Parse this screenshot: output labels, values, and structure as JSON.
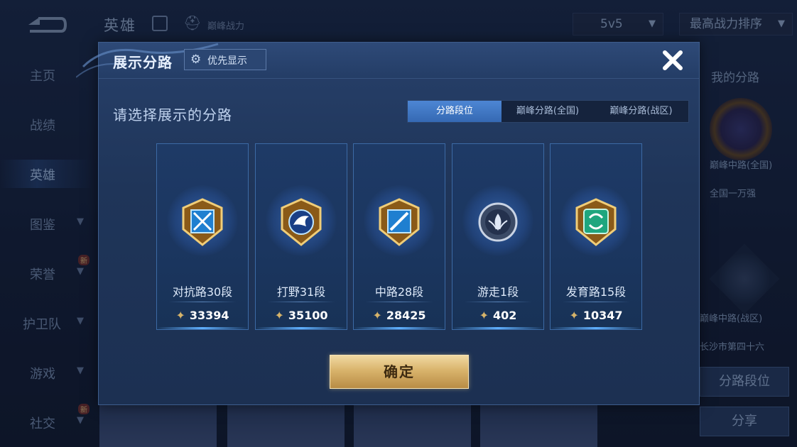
{
  "background": {
    "header_title": "英雄",
    "header_power_label": "巅峰战力",
    "mode_select": "5v5",
    "sort_select": "最高战力排序",
    "sidebar": [
      {
        "label": "主页",
        "chevron": false,
        "new": false
      },
      {
        "label": "战绩",
        "chevron": false,
        "new": false
      },
      {
        "label": "英雄",
        "chevron": false,
        "new": false,
        "active": true
      },
      {
        "label": "图鉴",
        "chevron": true,
        "new": false
      },
      {
        "label": "荣誉",
        "chevron": true,
        "new": true
      },
      {
        "label": "护卫队",
        "chevron": true,
        "new": false
      },
      {
        "label": "游戏",
        "chevron": true,
        "new": false
      },
      {
        "label": "社交",
        "chevron": true,
        "new": true
      }
    ],
    "new_badge": "新",
    "right_panel": {
      "title": "我的分路",
      "line1": "巅峰中路(全国)",
      "line2": "全国一万强",
      "line3": "巅峰中路(战区)",
      "line4": "长沙市第四十六",
      "btn1": "分路段位",
      "btn2": "分享"
    }
  },
  "modal": {
    "title": "展示分路",
    "priority_button": "优先显示",
    "subtitle": "请选择展示的分路",
    "tabs": [
      {
        "label": "分路段位",
        "active": true
      },
      {
        "label": "巅峰分路(全国)",
        "active": false
      },
      {
        "label": "巅峰分路(战区)",
        "active": false
      }
    ],
    "cards": [
      {
        "lane": "对抗路30段",
        "score": "33394",
        "emblem": "clash-lane-emblem",
        "color": "#3aa8e8"
      },
      {
        "lane": "打野31段",
        "score": "35100",
        "emblem": "jungle-emblem",
        "color": "#3aa8e8"
      },
      {
        "lane": "中路28段",
        "score": "28425",
        "emblem": "mid-lane-emblem",
        "color": "#3aa8e8"
      },
      {
        "lane": "游走1段",
        "score": "402",
        "emblem": "roam-emblem",
        "color": "#9aa8c0"
      },
      {
        "lane": "发育路15段",
        "score": "10347",
        "emblem": "farm-lane-emblem",
        "color": "#2fc49a"
      }
    ],
    "confirm_button": "确定"
  }
}
